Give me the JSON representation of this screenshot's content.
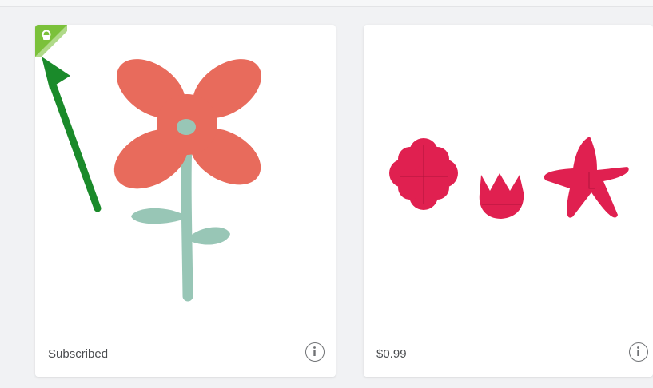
{
  "cards": [
    {
      "footer_text": "Subscribed",
      "image_name": "pink flower with green stem",
      "badge_icon": "subscription-badge-icon",
      "info_icon": "info-icon"
    },
    {
      "footer_text": "$0.99",
      "image_name": "three red puzzle flowers",
      "info_icon": "info-icon"
    }
  ],
  "colors": {
    "petal": "#e86b5c",
    "stem": "#98c6b6",
    "puzzle": "#e02050",
    "badge": "#7cc13a",
    "arrow": "#1a8a2a"
  }
}
